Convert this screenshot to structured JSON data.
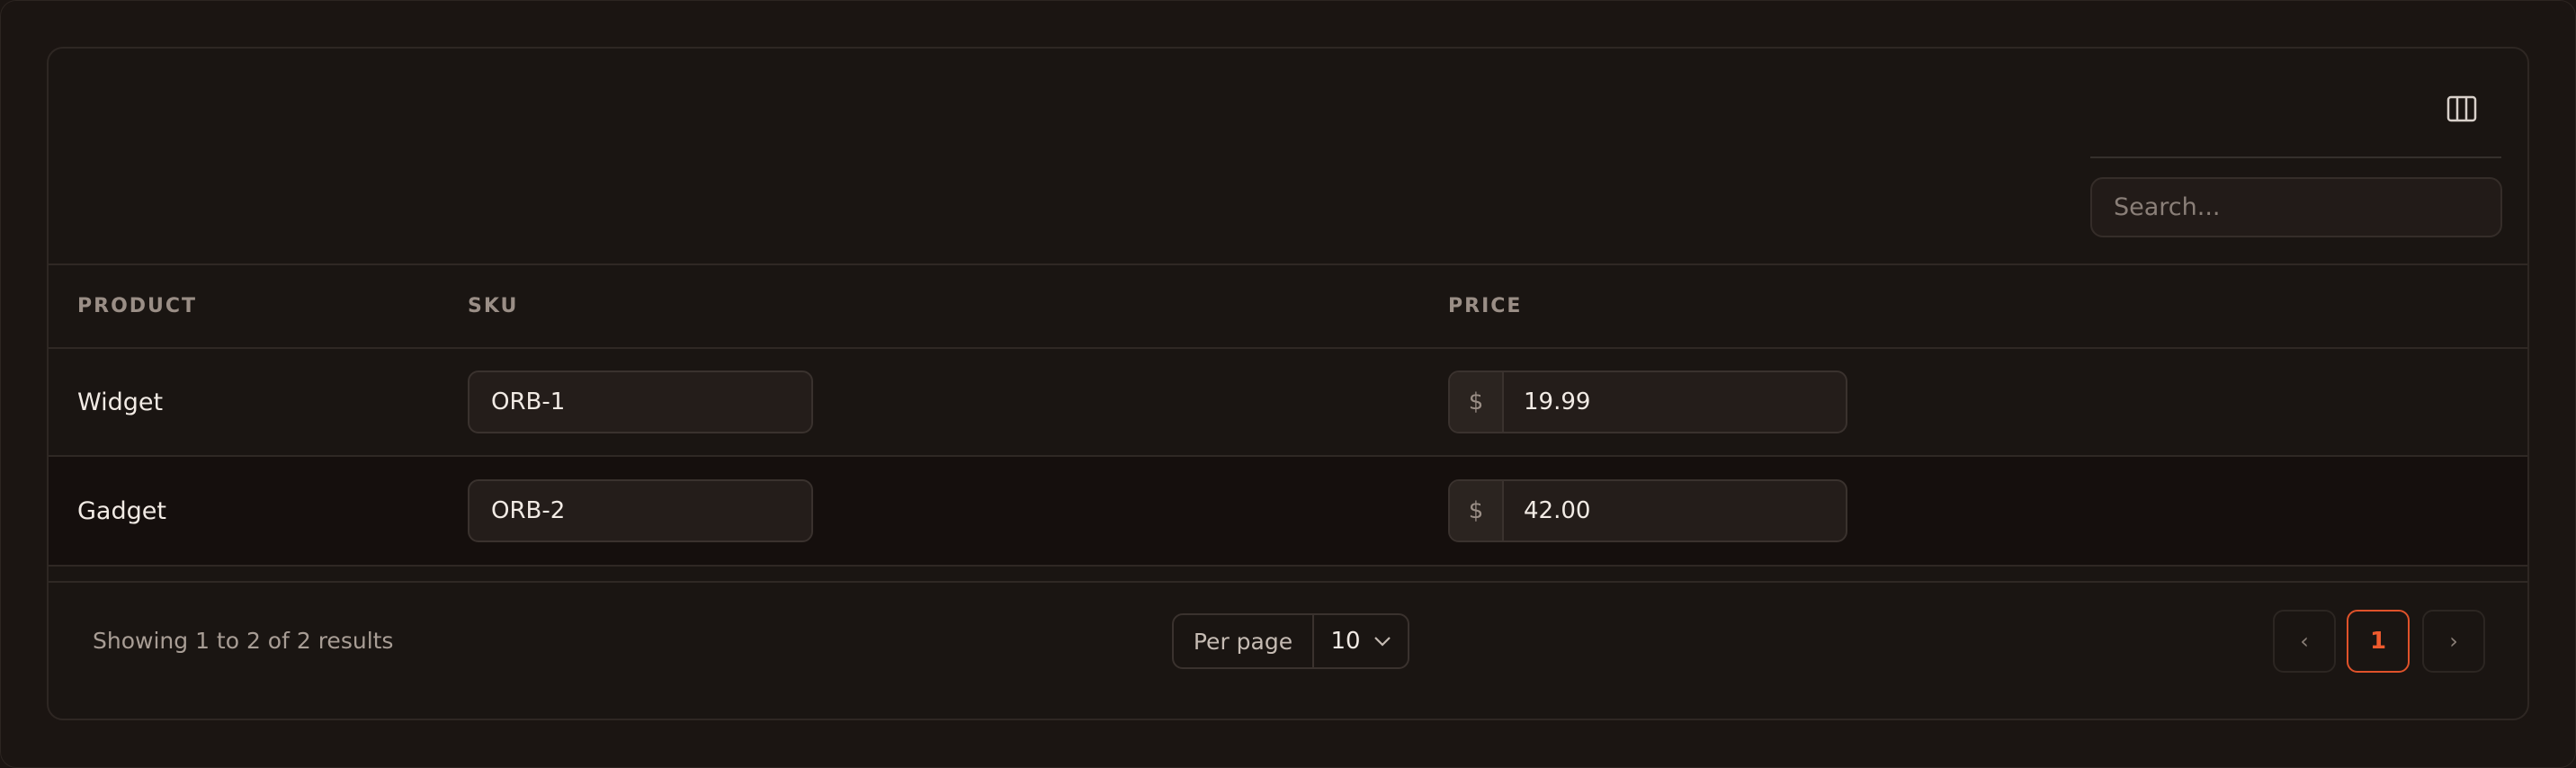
{
  "toolbar": {
    "columns_icon": "columns-icon",
    "search_placeholder": "Search..."
  },
  "table": {
    "columns": [
      "PRODUCT",
      "SKU",
      "PRICE"
    ],
    "rows": [
      {
        "product": "Widget",
        "sku": "ORB-1",
        "currency": "$",
        "price": "19.99"
      },
      {
        "product": "Gadget",
        "sku": "ORB-2",
        "currency": "$",
        "price": "42.00"
      }
    ]
  },
  "footer": {
    "summary": "Showing 1 to 2 of 2 results",
    "per_page_label": "Per page",
    "per_page_value": "10",
    "prev_label": "‹",
    "current_page": "1",
    "next_label": "›"
  },
  "colors": {
    "accent": "#e0522a",
    "background": "#1a1512"
  }
}
